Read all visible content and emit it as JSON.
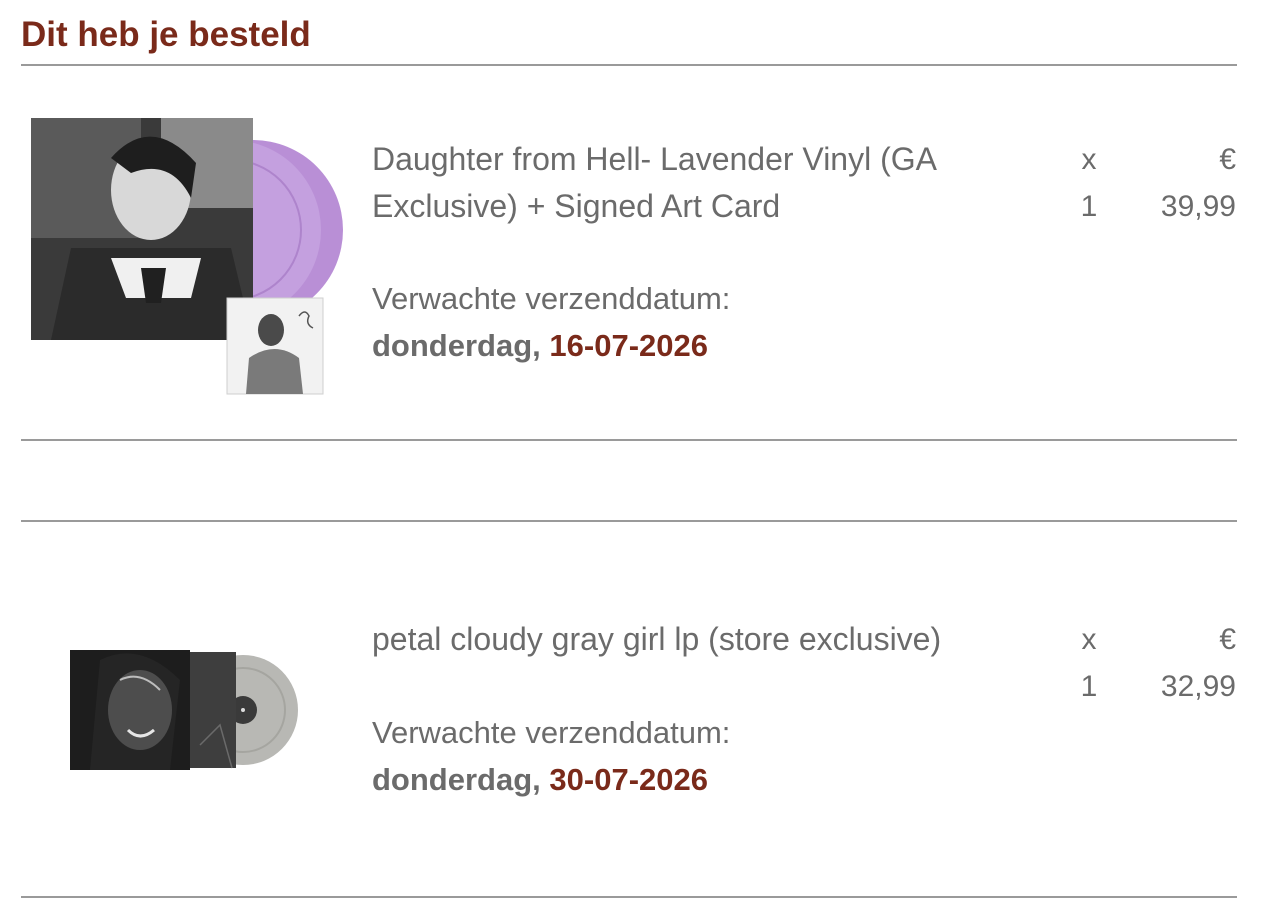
{
  "heading": "Dit heb je besteld",
  "items": [
    {
      "title": "Daughter from Hell- Lavender Vinyl (GA Exclusive) + Signed Art Card",
      "qty_symbol": "x",
      "qty_value": "1",
      "currency": "€",
      "price": "39,99",
      "shipping_label": "Verwachte verzenddatum:",
      "shipping_day": "donderdag,",
      "shipping_date": "16-07-2026",
      "image": "album-cover-lavender-vinyl-with-signed-art-card",
      "colors": {
        "vinyl": "#b98fd6"
      }
    },
    {
      "title": "petal cloudy gray girl lp (store exclusive)",
      "qty_symbol": "x",
      "qty_value": "1",
      "currency": "€",
      "price": "32,99",
      "shipping_label": "Verwachte verzenddatum:",
      "shipping_day": "donderdag,",
      "shipping_date": "30-07-2026",
      "image": "album-cover-cloudy-gray-vinyl",
      "colors": {
        "vinyl": "#b8b8b4"
      }
    }
  ],
  "colors": {
    "accent": "#7a2a1a",
    "text": "#6b6b6b",
    "rule": "#9a9a9a"
  }
}
